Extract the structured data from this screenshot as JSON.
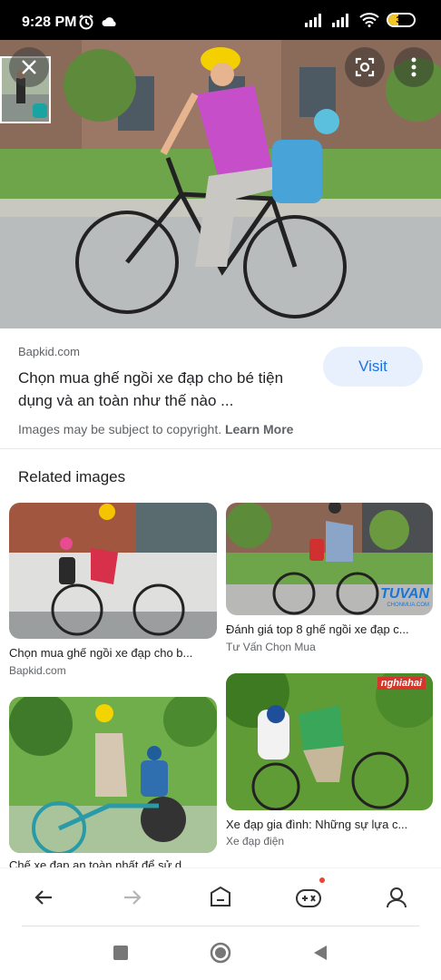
{
  "status_bar": {
    "time": "9:28 PM",
    "battery": "38"
  },
  "detail": {
    "source": "Bapkid.com",
    "title": "Chọn mua ghế ngồi xe đạp cho bé tiện dụng và an toàn như thế nào ...",
    "visit_label": "Visit",
    "copyright_text": "Images may be subject to copyright.",
    "learn_more": "Learn More"
  },
  "related": {
    "heading": "Related images",
    "items": [
      {
        "caption": "Chọn mua ghế ngồi xe đạp cho b...",
        "source": "Bapkid.com"
      },
      {
        "caption": "Đánh giá top 8 ghế ngồi xe đạp c...",
        "source": "Tư Vấn Chọn Mua"
      },
      {
        "caption": "Chế xe đạp an toàn nhất để sử d...",
        "source": ""
      },
      {
        "caption": "Xe đạp gia đình: Những sự lựa c...",
        "source": "Xe đạp điện"
      }
    ],
    "watermarks": {
      "tuvan": "TUVAN",
      "tuvan_sub": "CHONMUA.COM",
      "nghiahai": "nghiahai"
    }
  },
  "icons": {
    "close": "close-icon",
    "lens": "lens-icon",
    "more": "more-vert-icon",
    "back": "back-arrow-icon",
    "forward": "forward-arrow-icon",
    "tabs": "tabs-icon",
    "games": "gamepad-icon",
    "account": "account-icon",
    "sys_recent": "square-icon",
    "sys_home": "circle-icon",
    "sys_back": "triangle-icon"
  },
  "colors": {
    "accent": "#1a73e8",
    "visit_bg": "#e8f0fe",
    "notification_dot": "#ea4335"
  }
}
